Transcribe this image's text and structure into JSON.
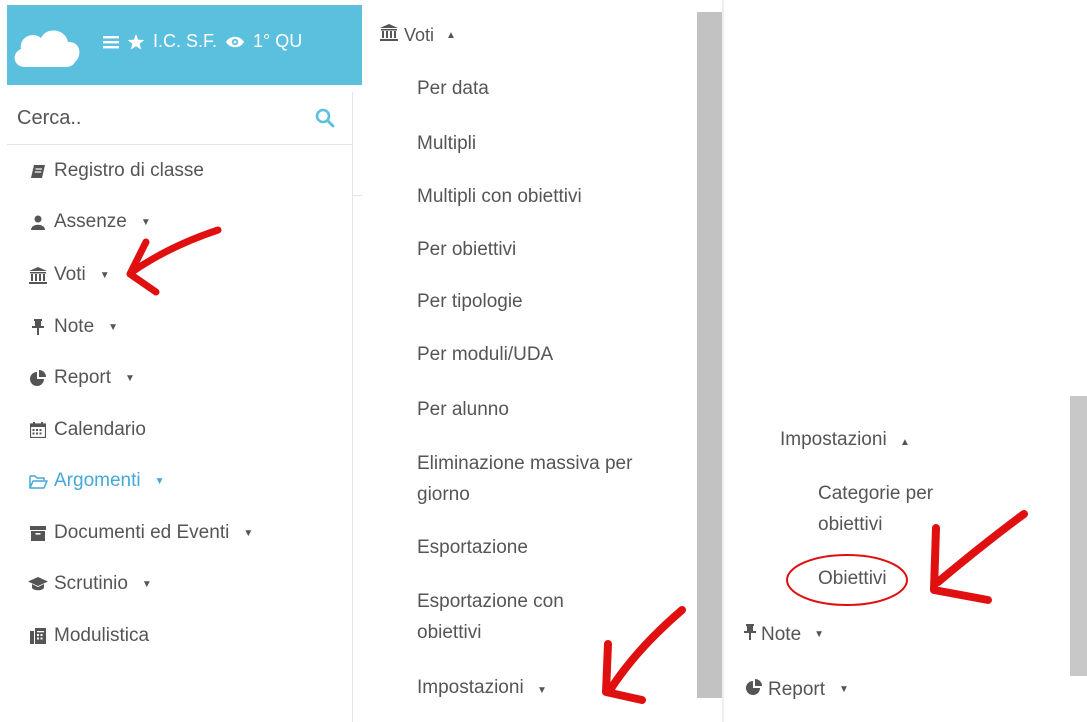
{
  "topbar": {
    "menu_icon": "hamburger-icon",
    "star_icon": "star-icon",
    "school": "I.C. S.F.",
    "eye_icon": "eye-icon",
    "period": "1° QU",
    "color": "#5bbfde"
  },
  "search": {
    "placeholder": "Cerca.."
  },
  "sidebar": {
    "items": [
      {
        "label": "Registro di classe",
        "icon": "book-icon"
      },
      {
        "label": "Assenze",
        "icon": "user-icon"
      },
      {
        "label": "Voti",
        "icon": "institution-icon"
      },
      {
        "label": "Note",
        "icon": "pin-icon"
      },
      {
        "label": "Report",
        "icon": "pie-chart-icon"
      },
      {
        "label": "Calendario",
        "icon": "calendar-icon"
      },
      {
        "label": "Argomenti",
        "icon": "folder-open-icon"
      },
      {
        "label": "Documenti ed Eventi",
        "icon": "archive-icon"
      },
      {
        "label": "Scrutinio",
        "icon": "graduation-cap-icon"
      },
      {
        "label": "Modulistica",
        "icon": "file-icon"
      }
    ],
    "active_color": "#45a8d6"
  },
  "voti_menu": {
    "header": "Voti",
    "items": [
      "Per data",
      "Multipli",
      "Multipli con obiettivi",
      "Per obiettivi",
      "Per tipologie",
      "Per moduli/UDA",
      "Per alunno",
      "Eliminazione massiva per giorno",
      "Esportazione",
      "Esportazione con obiettivi",
      "Impostazioni"
    ]
  },
  "impostazioni_menu": {
    "header": "Impostazioni",
    "items": [
      "Categorie per obiettivi",
      "Obiettivi"
    ],
    "after": [
      "Note",
      "Report"
    ]
  },
  "annotation_color": "#e01010"
}
